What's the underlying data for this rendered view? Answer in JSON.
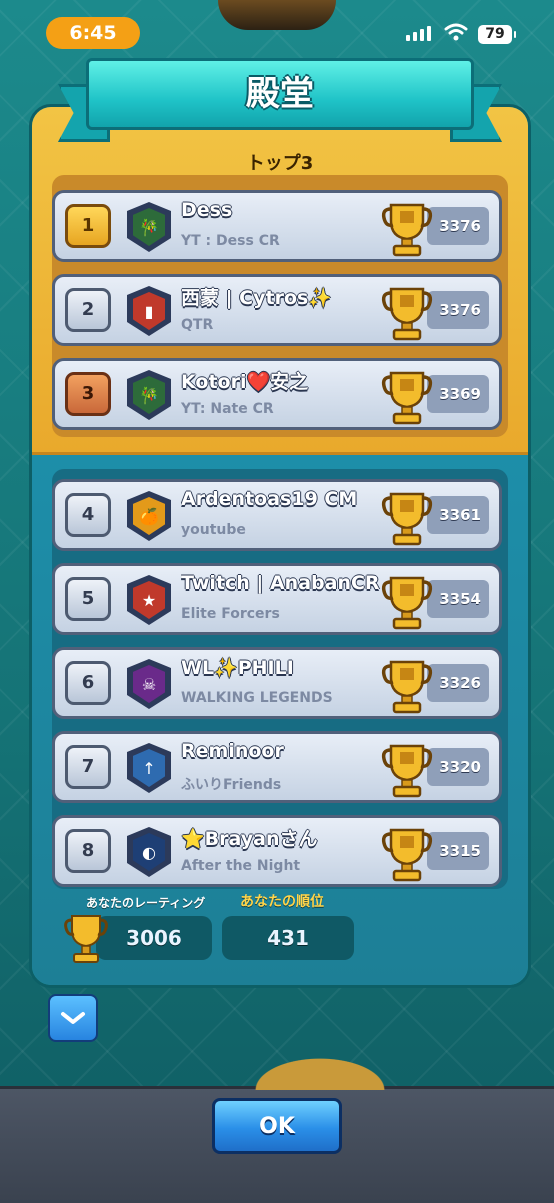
{
  "status_bar": {
    "time": "6:45",
    "battery": "79"
  },
  "header": {
    "title": "殿堂",
    "section_title": "トップ3"
  },
  "players": [
    {
      "rank": "1",
      "name": "Dess",
      "clan": "YT : Dess CR",
      "trophies": "3376",
      "badge_color": "#2d6b3a",
      "badge_symbol": "bamboo"
    },
    {
      "rank": "2",
      "name": "西蒙 | Cytros✨",
      "clan": "QTR",
      "trophies": "3376",
      "badge_color": "#c0392b",
      "badge_symbol": "flag"
    },
    {
      "rank": "3",
      "name": "Kotori❤️安之",
      "clan": "YT: Nate CR",
      "trophies": "3369",
      "badge_color": "#2d6b3a",
      "badge_symbol": "bamboo"
    },
    {
      "rank": "4",
      "name": "Ardentoas19 CM",
      "clan": "youtube",
      "trophies": "3361",
      "badge_color": "#e39a1a",
      "badge_symbol": "fruit"
    },
    {
      "rank": "5",
      "name": "Twitch | AnabanCR",
      "clan": "Elite Forcers",
      "trophies": "3354",
      "badge_color": "#c0392b",
      "badge_symbol": "star"
    },
    {
      "rank": "6",
      "name": "WL✨PHILI",
      "clan": "WALKING LEGENDS",
      "trophies": "3326",
      "badge_color": "#6a2a8a",
      "badge_symbol": "skull"
    },
    {
      "rank": "7",
      "name": "Reminoor",
      "clan": "ふいりFriends",
      "trophies": "3320",
      "badge_color": "#2e6bb0",
      "badge_symbol": "arrow"
    },
    {
      "rank": "8",
      "name": "⭐Brayanさん",
      "clan": "After the Night",
      "trophies": "3315",
      "badge_color": "#1e3f75",
      "badge_symbol": "moon"
    }
  ],
  "stats": {
    "rating_label": "あなたのレーティング",
    "rating_value": "3006",
    "rank_label": "あなたの順位",
    "rank_value": "431"
  },
  "buttons": {
    "ok_label": "OK",
    "expand_icon": "chevron-down-icon"
  },
  "colors": {
    "gold_panel": "#f2c444",
    "blue_panel": "#1d8ea9",
    "ok_button": "#2a8fe8"
  }
}
